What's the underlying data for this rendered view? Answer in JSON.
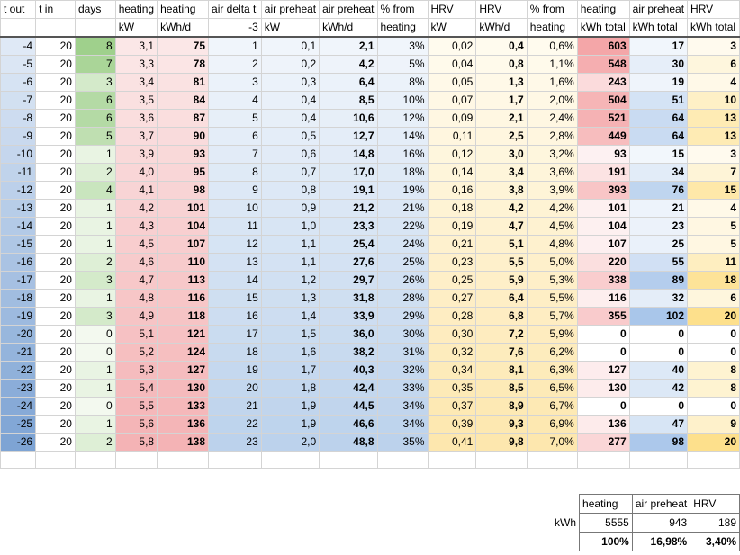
{
  "columns": [
    {
      "h1": "t out",
      "h2": ""
    },
    {
      "h1": "t in",
      "h2": ""
    },
    {
      "h1": "days",
      "h2": ""
    },
    {
      "h1": "heating",
      "h2": "kW"
    },
    {
      "h1": "heating",
      "h2": "kWh/d"
    },
    {
      "h1": "air delta t",
      "h2": "-3"
    },
    {
      "h1": "air preheat",
      "h2": "kW"
    },
    {
      "h1": "air preheat",
      "h2": "kWh/d"
    },
    {
      "h1": "% from",
      "h2": "heating"
    },
    {
      "h1": "HRV",
      "h2": "kW"
    },
    {
      "h1": "HRV",
      "h2": "kWh/d"
    },
    {
      "h1": "% from",
      "h2": "heating"
    },
    {
      "h1": "heating",
      "h2": "kWh total"
    },
    {
      "h1": "air preheat",
      "h2": "kWh total"
    },
    {
      "h1": "HRV",
      "h2": "kWh total"
    }
  ],
  "rows": [
    [
      "-4",
      "20",
      "8",
      "3,1",
      "75",
      "1",
      "0,1",
      "2,1",
      "3%",
      "0,02",
      "0,4",
      "0,6%",
      "603",
      "17",
      "3"
    ],
    [
      "-5",
      "20",
      "7",
      "3,3",
      "78",
      "2",
      "0,2",
      "4,2",
      "5%",
      "0,04",
      "0,8",
      "1,1%",
      "548",
      "30",
      "6"
    ],
    [
      "-6",
      "20",
      "3",
      "3,4",
      "81",
      "3",
      "0,3",
      "6,4",
      "8%",
      "0,05",
      "1,3",
      "1,6%",
      "243",
      "19",
      "4"
    ],
    [
      "-7",
      "20",
      "6",
      "3,5",
      "84",
      "4",
      "0,4",
      "8,5",
      "10%",
      "0,07",
      "1,7",
      "2,0%",
      "504",
      "51",
      "10"
    ],
    [
      "-8",
      "20",
      "6",
      "3,6",
      "87",
      "5",
      "0,4",
      "10,6",
      "12%",
      "0,09",
      "2,1",
      "2,4%",
      "521",
      "64",
      "13"
    ],
    [
      "-9",
      "20",
      "5",
      "3,7",
      "90",
      "6",
      "0,5",
      "12,7",
      "14%",
      "0,11",
      "2,5",
      "2,8%",
      "449",
      "64",
      "13"
    ],
    [
      "-10",
      "20",
      "1",
      "3,9",
      "93",
      "7",
      "0,6",
      "14,8",
      "16%",
      "0,12",
      "3,0",
      "3,2%",
      "93",
      "15",
      "3"
    ],
    [
      "-11",
      "20",
      "2",
      "4,0",
      "95",
      "8",
      "0,7",
      "17,0",
      "18%",
      "0,14",
      "3,4",
      "3,6%",
      "191",
      "34",
      "7"
    ],
    [
      "-12",
      "20",
      "4",
      "4,1",
      "98",
      "9",
      "0,8",
      "19,1",
      "19%",
      "0,16",
      "3,8",
      "3,9%",
      "393",
      "76",
      "15"
    ],
    [
      "-13",
      "20",
      "1",
      "4,2",
      "101",
      "10",
      "0,9",
      "21,2",
      "21%",
      "0,18",
      "4,2",
      "4,2%",
      "101",
      "21",
      "4"
    ],
    [
      "-14",
      "20",
      "1",
      "4,3",
      "104",
      "11",
      "1,0",
      "23,3",
      "22%",
      "0,19",
      "4,7",
      "4,5%",
      "104",
      "23",
      "5"
    ],
    [
      "-15",
      "20",
      "1",
      "4,5",
      "107",
      "12",
      "1,1",
      "25,4",
      "24%",
      "0,21",
      "5,1",
      "4,8%",
      "107",
      "25",
      "5"
    ],
    [
      "-16",
      "20",
      "2",
      "4,6",
      "110",
      "13",
      "1,1",
      "27,6",
      "25%",
      "0,23",
      "5,5",
      "5,0%",
      "220",
      "55",
      "11"
    ],
    [
      "-17",
      "20",
      "3",
      "4,7",
      "113",
      "14",
      "1,2",
      "29,7",
      "26%",
      "0,25",
      "5,9",
      "5,3%",
      "338",
      "89",
      "18"
    ],
    [
      "-18",
      "20",
      "1",
      "4,8",
      "116",
      "15",
      "1,3",
      "31,8",
      "28%",
      "0,27",
      "6,4",
      "5,5%",
      "116",
      "32",
      "6"
    ],
    [
      "-19",
      "20",
      "3",
      "4,9",
      "118",
      "16",
      "1,4",
      "33,9",
      "29%",
      "0,28",
      "6,8",
      "5,7%",
      "355",
      "102",
      "20"
    ],
    [
      "-20",
      "20",
      "0",
      "5,1",
      "121",
      "17",
      "1,5",
      "36,0",
      "30%",
      "0,30",
      "7,2",
      "5,9%",
      "0",
      "0",
      "0"
    ],
    [
      "-21",
      "20",
      "0",
      "5,2",
      "124",
      "18",
      "1,6",
      "38,2",
      "31%",
      "0,32",
      "7,6",
      "6,2%",
      "0",
      "0",
      "0"
    ],
    [
      "-22",
      "20",
      "1",
      "5,3",
      "127",
      "19",
      "1,7",
      "40,3",
      "32%",
      "0,34",
      "8,1",
      "6,3%",
      "127",
      "40",
      "8"
    ],
    [
      "-23",
      "20",
      "1",
      "5,4",
      "130",
      "20",
      "1,8",
      "42,4",
      "33%",
      "0,35",
      "8,5",
      "6,5%",
      "130",
      "42",
      "8"
    ],
    [
      "-24",
      "20",
      "0",
      "5,5",
      "133",
      "21",
      "1,9",
      "44,5",
      "34%",
      "0,37",
      "8,9",
      "6,7%",
      "0",
      "0",
      "0"
    ],
    [
      "-25",
      "20",
      "1",
      "5,6",
      "136",
      "22",
      "1,9",
      "46,6",
      "34%",
      "0,39",
      "9,3",
      "6,9%",
      "136",
      "47",
      "9"
    ],
    [
      "-26",
      "20",
      "2",
      "5,8",
      "138",
      "23",
      "2,0",
      "48,8",
      "35%",
      "0,41",
      "9,8",
      "7,0%",
      "277",
      "98",
      "20"
    ]
  ],
  "summary": {
    "headers": [
      "heating",
      "air preheat",
      "HRV"
    ],
    "unit": "kWh",
    "totals": [
      "5555",
      "943",
      "189"
    ],
    "percents": [
      "100%",
      "16,98%",
      "3,40%"
    ]
  },
  "colors": {
    "tout_light": "#dfe9f6",
    "tout_dark": "#7ea4d4",
    "days_light": "#f3f9ef",
    "days_dark": "#9fd08c",
    "heat_light": "#fbe7e7",
    "heat_dark": "#f4b3b5",
    "blue_light": "#f0f5fb",
    "blue_dark": "#bcd2ec",
    "yellow_light": "#fffbee",
    "yellow_dark": "#fde7ae",
    "heat_total_dark": "#f4a6a8",
    "air_total_dark": "#a9c6ea",
    "hrv_total_dark": "#fde08c"
  }
}
